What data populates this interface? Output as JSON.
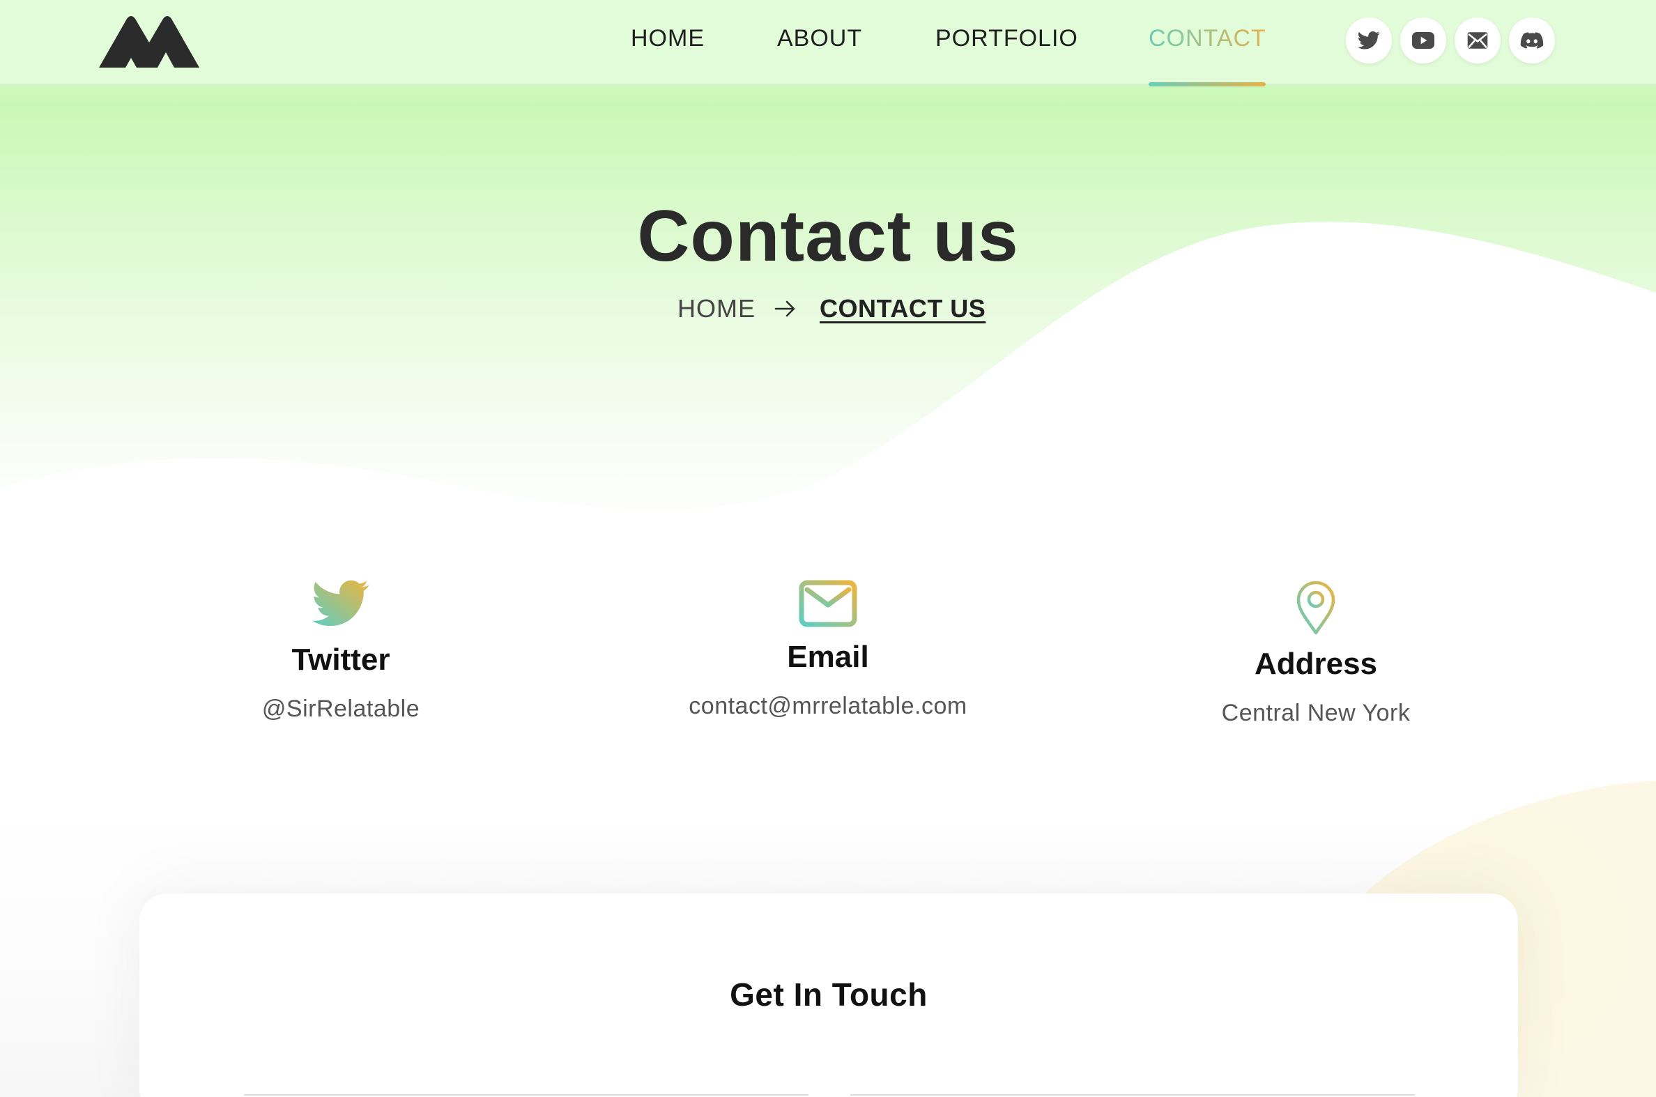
{
  "nav": {
    "logo": "mountain-logo",
    "links": [
      {
        "label": "HOME"
      },
      {
        "label": "ABOUT"
      },
      {
        "label": "PORTFOLIO"
      },
      {
        "label": "CONTACT",
        "active": true
      }
    ],
    "social_icons": [
      "twitter-icon",
      "youtube-icon",
      "mail-icon",
      "discord-icon"
    ]
  },
  "hero": {
    "title": "Contact us",
    "breadcrumb": {
      "home": "HOME",
      "current": "CONTACT US"
    }
  },
  "info_cards": [
    {
      "icon": "twitter-icon",
      "title": "Twitter",
      "value": "@SirRelatable"
    },
    {
      "icon": "mail-icon",
      "title": "Email",
      "value": "contact@mrrelatable.com"
    },
    {
      "icon": "location-pin-icon",
      "title": "Address",
      "value": "Central New York"
    }
  ],
  "contact_form": {
    "heading": "Get In Touch"
  },
  "colors": {
    "accent_start": "#6bcdb9",
    "accent_end": "#e3b24a",
    "nav_bg": "#e2fbd8",
    "hero_green": "#c9f8b6",
    "text_dark": "#1e1e1e"
  }
}
